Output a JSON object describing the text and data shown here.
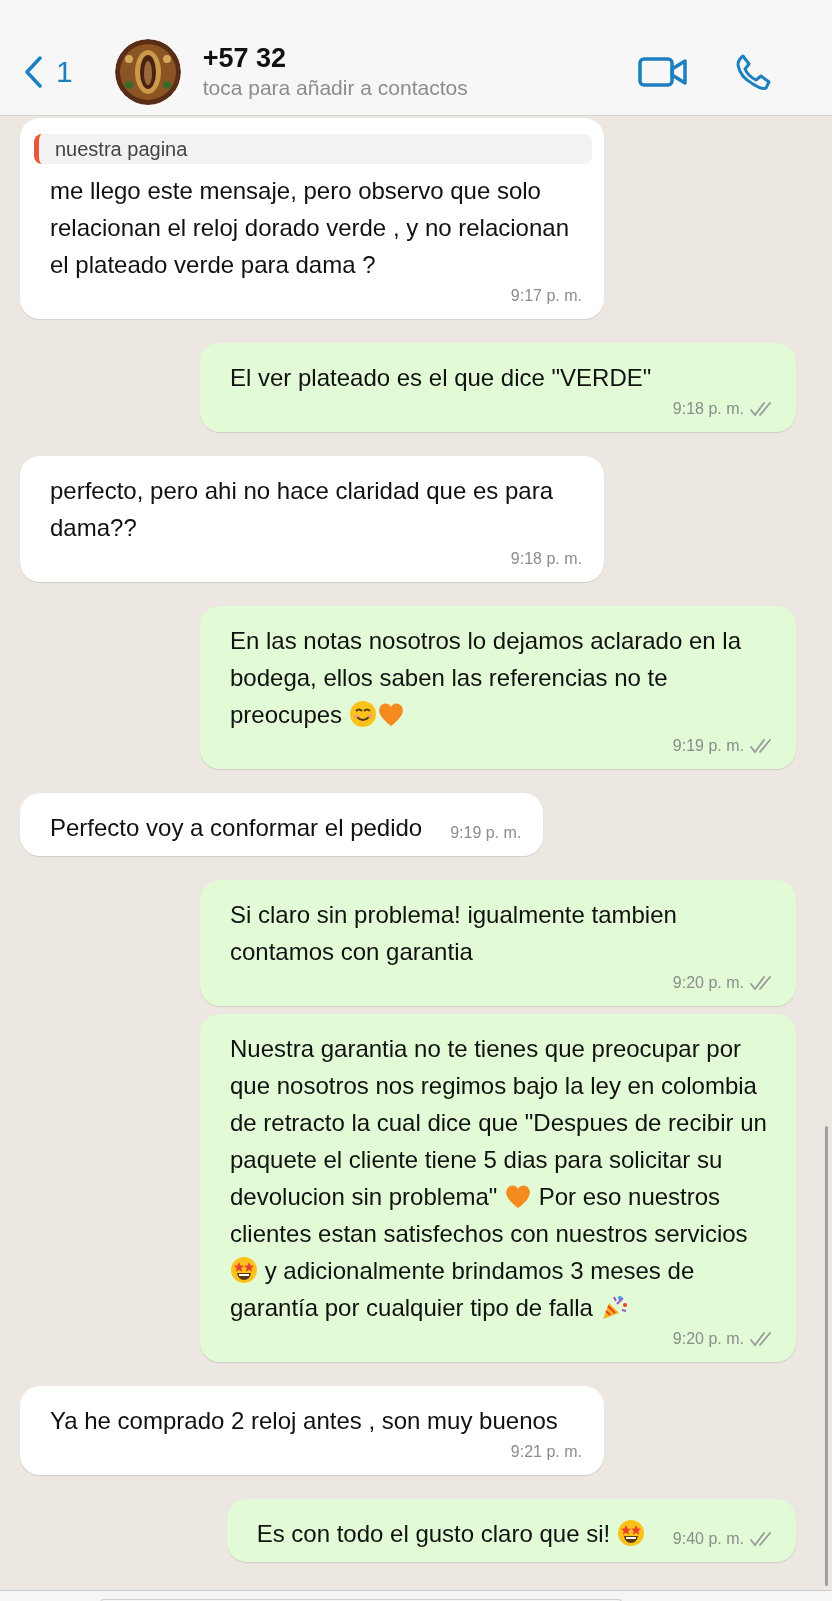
{
  "header": {
    "back_count": "1",
    "name": "+57 32",
    "subtitle": "toca para añadir a contactos"
  },
  "messages": [
    {
      "kind": "incoming",
      "quote": "nuestra pagina",
      "parts": [
        {
          "kind": "text",
          "text": "me llego este mensaje, pero observo que solo relacionan el reloj dorado verde , y no relacionan el plateado verde para dama ?"
        }
      ],
      "time": "9:17 p. m."
    },
    {
      "kind": "outgoing",
      "read": false,
      "parts": [
        {
          "kind": "text",
          "text": "El ver plateado es el que dice \"VERDE\""
        }
      ],
      "time": "9:18 p. m."
    },
    {
      "kind": "incoming",
      "parts": [
        {
          "kind": "text",
          "text": "perfecto, pero ahi no hace claridad que es para dama??"
        }
      ],
      "time": "9:18 p. m."
    },
    {
      "kind": "outgoing",
      "read": false,
      "parts": [
        {
          "kind": "text",
          "text": "En las notas nosotros lo dejamos aclarado en la bodega, ellos saben las referencias no te preocupes "
        },
        {
          "kind": "smile"
        },
        {
          "kind": "heart"
        }
      ],
      "time": "9:19 p. m."
    },
    {
      "kind": "incoming",
      "parts": [
        {
          "kind": "text",
          "text": "Perfecto voy a conformar el pedido"
        }
      ],
      "time": "9:19 p. m."
    },
    {
      "kind": "outgoing",
      "read": false,
      "parts": [
        {
          "kind": "text",
          "text": "Si claro sin problema! igualmente tambien contamos con garantia"
        }
      ],
      "time": "9:20 p. m."
    },
    {
      "kind": "outgoing",
      "read": false,
      "parts": [
        {
          "kind": "text",
          "text": "Nuestra garantia no te tienes que preocupar por que nosotros nos regimos bajo la ley en colombia de retracto la cual dice que \"Despues de recibir un paquete el cliente tiene 5 dias para solicitar su devolucion sin problema\" "
        },
        {
          "kind": "heart"
        },
        {
          "kind": "text",
          "text": " Por eso nuestros clientes estan satisfechos con nuestros servicios "
        },
        {
          "kind": "stareyes"
        },
        {
          "kind": "text",
          "text": " y adicionalmente brindamos 3 meses de garantía por cualquier tipo de falla "
        },
        {
          "kind": "party"
        }
      ],
      "time": "9:20 p. m."
    },
    {
      "kind": "incoming",
      "parts": [
        {
          "kind": "text",
          "text": "Ya he comprado 2 reloj antes , son muy buenos"
        }
      ],
      "time": "9:21 p. m."
    },
    {
      "kind": "outgoing",
      "read": false,
      "parts": [
        {
          "kind": "text",
          "text": "Es con todo el gusto claro que si! "
        },
        {
          "kind": "stareyes"
        }
      ],
      "time": "9:40 p. m."
    }
  ]
}
